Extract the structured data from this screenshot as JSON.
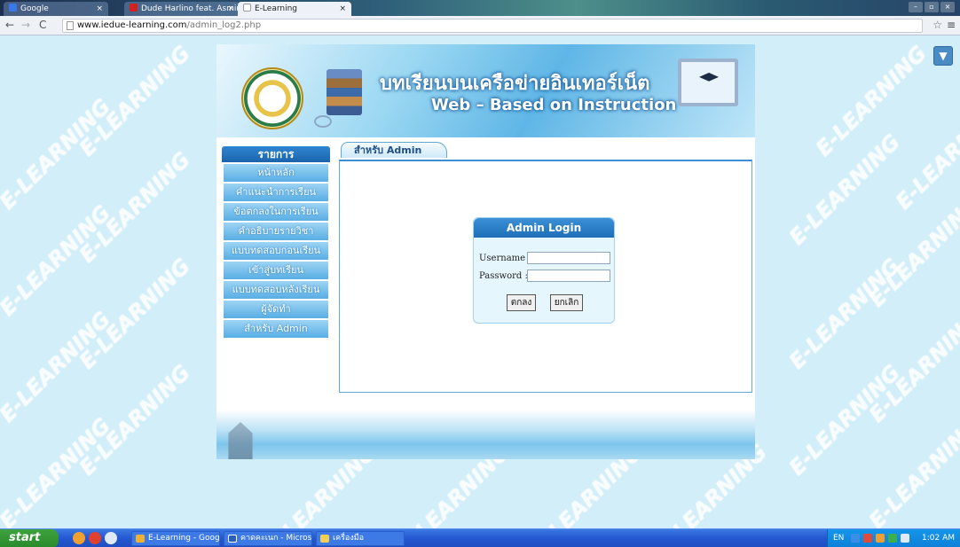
{
  "browser": {
    "tabs": [
      {
        "label": "Google"
      },
      {
        "label": "Dude Harlino feat. Asmirand"
      },
      {
        "label": "E-Learning"
      }
    ],
    "url_host": "www.iedue-learning.com",
    "url_path": "/admin_log2.php"
  },
  "banner": {
    "thai_title": "บทเรียนบนเครือข่ายอินเทอร์เน็ต",
    "english_title": "Web – Based on Instruction"
  },
  "watermark": "E-LEARNING",
  "sidebar": {
    "header": "รายการ",
    "items": [
      {
        "label": "หน้าหลัก"
      },
      {
        "label": "คำแนะนำการเรียน"
      },
      {
        "label": "ข้อตกลงในการเรียน"
      },
      {
        "label": "คำอธิบายรายวิชา"
      },
      {
        "label": "แบบทดสอบก่อนเรียน"
      },
      {
        "label": "เข้าสู่บทเรียน"
      },
      {
        "label": "แบบทดสอบหลังเรียน"
      },
      {
        "label": "ผู้จัดทำ"
      },
      {
        "label": "สำหรับ Admin"
      }
    ]
  },
  "content_tab": "สำหรับ Admin",
  "login": {
    "title": "Admin Login",
    "username_label": "Username :",
    "password_label": "Password :",
    "username_value": "",
    "password_value": "",
    "ok_button": "ตกลง",
    "cancel_button": "ยกเลิก"
  },
  "taskbar": {
    "start": "start",
    "tasks": [
      {
        "label": "E-Learning - Google C..."
      },
      {
        "label": "คาดคะเนก - Microsoft ..."
      },
      {
        "label": "เครื่องมือ"
      }
    ],
    "tray_lang": "EN",
    "clock": "1:02 AM"
  },
  "colors": {
    "page_bg": "#d2eef8",
    "menu_blue": "#58aee4",
    "header_blue": "#1e6fb8",
    "taskbar_blue": "#2458d1",
    "start_green": "#2a8a2a"
  }
}
